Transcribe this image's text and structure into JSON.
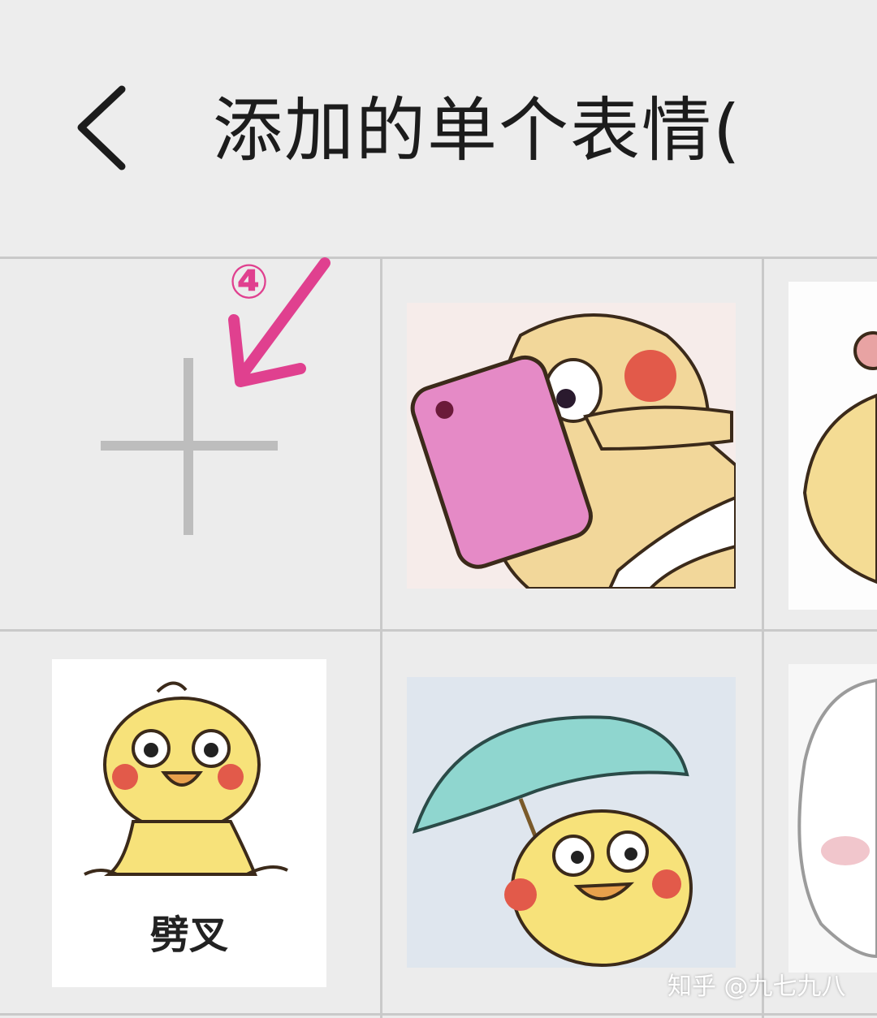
{
  "header": {
    "back_icon": "chevron-left-icon",
    "title": "添加的单个表情("
  },
  "grid": {
    "add_icon": "plus-icon",
    "step_marker": "④",
    "stickers": [
      {
        "name": "duck-phone-sticker",
        "caption": ""
      },
      {
        "name": "partial-sticker-right-top",
        "caption": ""
      },
      {
        "name": "duck-standing-sticker",
        "caption": "劈叉"
      },
      {
        "name": "duck-umbrella-sticker",
        "caption": ""
      },
      {
        "name": "partial-sticker-right-bottom",
        "caption": ""
      }
    ]
  },
  "watermark": "知乎 @九七九八",
  "colors": {
    "accent": "#e0408f",
    "background": "#ececec",
    "grid_line": "#c9c9c9"
  }
}
